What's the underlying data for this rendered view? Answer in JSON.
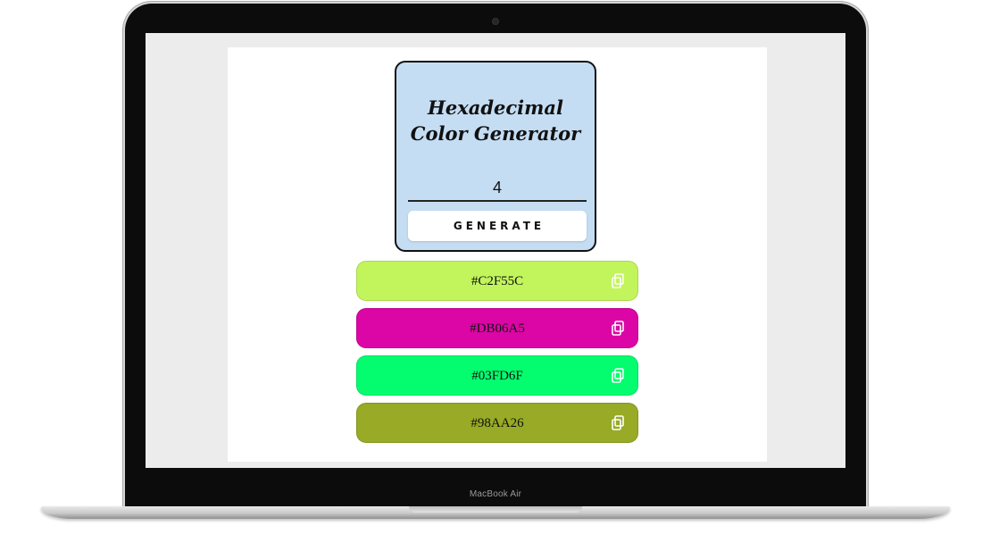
{
  "device": {
    "label": "MacBook Air"
  },
  "app": {
    "title": "Hexadecimal Color Generator",
    "count_value": "4",
    "generate_label": "GENERATE"
  },
  "colors": [
    {
      "hex": "#C2F55C",
      "icon": "copy-icon"
    },
    {
      "hex": "#DB06A5",
      "icon": "copy-icon"
    },
    {
      "hex": "#03FD6F",
      "icon": "copy-icon"
    },
    {
      "hex": "#98AA26",
      "icon": "copy-icon"
    }
  ],
  "palette": {
    "card_bg": "#C5DDF3",
    "screen_bg": "#ECECEC",
    "page_bg": "#FFFFFF"
  }
}
